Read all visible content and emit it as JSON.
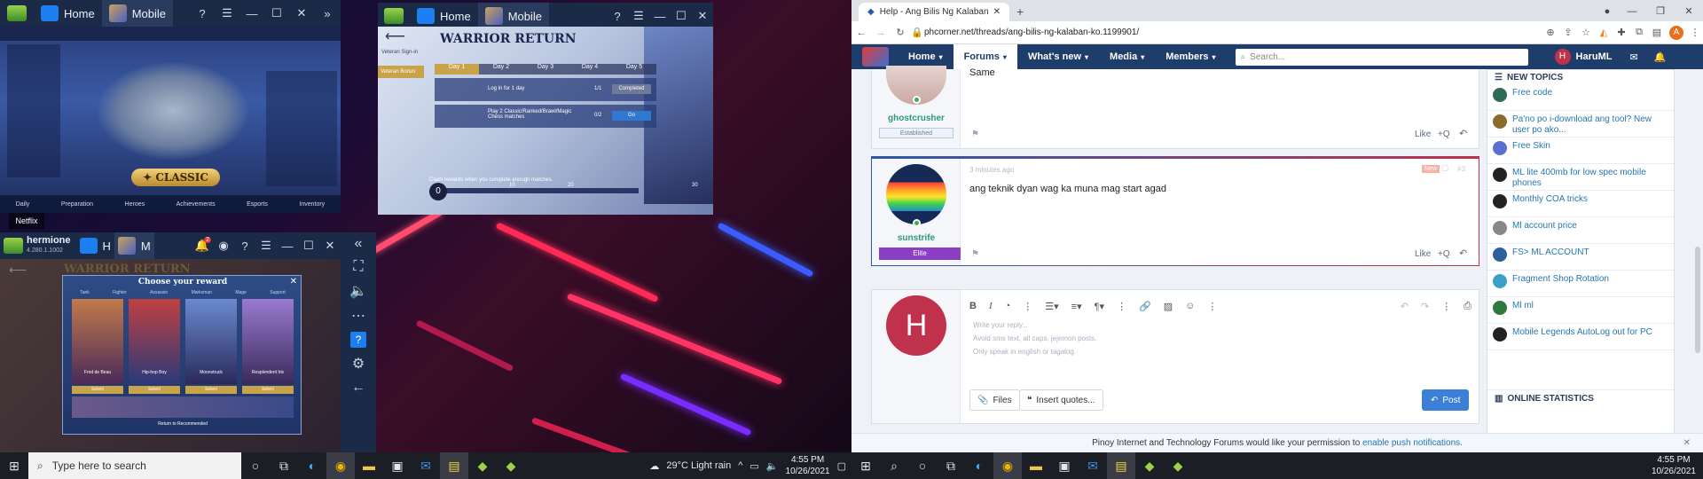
{
  "left": {
    "top_window_1": {
      "tab_home": "Home",
      "tab_app": "Mobile"
    },
    "top_window_2": {
      "tab_home": "Home",
      "tab_app": "Mobile"
    },
    "bottom_window": {
      "title": "hermione",
      "version": "4.280.1.1002",
      "tab_home": "H",
      "tab_app": "M",
      "badge": "2"
    },
    "game1": {
      "classic_label": "CLASSIC",
      "netflix_label": "Netflix",
      "bottom_nav": [
        "Daily",
        "Preparation",
        "Heroes",
        "Achievements",
        "Esports",
        "Inventory"
      ]
    },
    "game2": {
      "sign_in": "Veteran Sign-in",
      "veteran": "Veteran Bonus",
      "title": "WARRIOR RETURN",
      "days": [
        "Day 1",
        "Day 2",
        "Day 3",
        "Day 4",
        "Day 5"
      ],
      "tasks": [
        {
          "text": "Log in for 1 day",
          "progress": "1/1",
          "button": "Completed"
        },
        {
          "text": "Play 2 Classic/Ranked/Brawl/Magic Chess matches",
          "progress": "0/2",
          "button": "Go"
        }
      ],
      "claim_text": "Claim rewards when you complete enough matches.",
      "progress_start": "0",
      "milestones": [
        "10",
        "20",
        "30"
      ]
    },
    "game3": {
      "header": "WARRIOR RETURN",
      "dialog_title": "Choose your reward",
      "tabs": [
        "Tank",
        "Fighter",
        "Assassin",
        "Marksman",
        "Mage",
        "Support"
      ],
      "heroes": [
        "Fred de Beau",
        "Hip-hop Boy",
        "Moonstruck",
        "Resplendent Iris"
      ],
      "select_label": "Select",
      "return_label": "Return to Recommended"
    },
    "taskbar": {
      "search_placeholder": "Type here to search",
      "weather": "29°C  Light rain",
      "time": "4:55 PM",
      "date": "10/26/2021"
    }
  },
  "right": {
    "tab_title": "Help - Ang Bilis Ng Kalaban ko | ...",
    "url": "phcorner.net/threads/ang-bilis-ng-kalaban-ko.1199901/",
    "avatar_letter": "A",
    "nav": {
      "home": "Home",
      "forums": "Forums",
      "whats_new": "What's new",
      "media": "Media",
      "members": "Members",
      "search_placeholder": "Search...",
      "user": "HaruML",
      "user_initial": "H"
    },
    "post1": {
      "text": "Same",
      "username": "ghostcrusher",
      "badge": "Established",
      "like": "Like",
      "quote": "+Q"
    },
    "post2": {
      "time": "3 minutes ago",
      "new_badge": "New",
      "number": "#3",
      "text": "ang teknik dyan wag ka muna mag start agad",
      "username": "sunstrife",
      "badge": "Elite",
      "like": "Like",
      "quote": "+Q"
    },
    "reply": {
      "avatar_letter": "H",
      "placeholder_lines": [
        "Write your reply...",
        "Avoid sms text, all caps, jejemon posts.",
        "Only speak in english or tagalog."
      ],
      "files": "Files",
      "insert_quotes": "Insert quotes...",
      "post": "Post"
    },
    "sidebar": {
      "new_topics": "NEW TOPICS",
      "items": [
        "Free code",
        "Pa'no po i-download ang tool? New user po ako...",
        "Free Skin",
        "ML lite 400mb for low spec mobile phones",
        "Monthly COA tricks",
        "Ml account price",
        "FS> ML ACCOUNT",
        "Fragment Shop Rotation",
        "Ml ml",
        "Mobile Legends AutoLog out for PC"
      ],
      "item_colors": [
        "#2f6b54",
        "#8a6b2a",
        "#5b6fd0",
        "#222",
        "#222",
        "#888",
        "#2d5f9a",
        "#3aa0c8",
        "#2f7a3a",
        "#222"
      ],
      "online_stats": "ONLINE STATISTICS"
    },
    "notification": {
      "text": "Pinoy Internet and Technology Forums would like your permission to",
      "link": "enable push notifications."
    },
    "taskbar": {
      "time": "4:55 PM",
      "date": "10/26/2021"
    }
  }
}
